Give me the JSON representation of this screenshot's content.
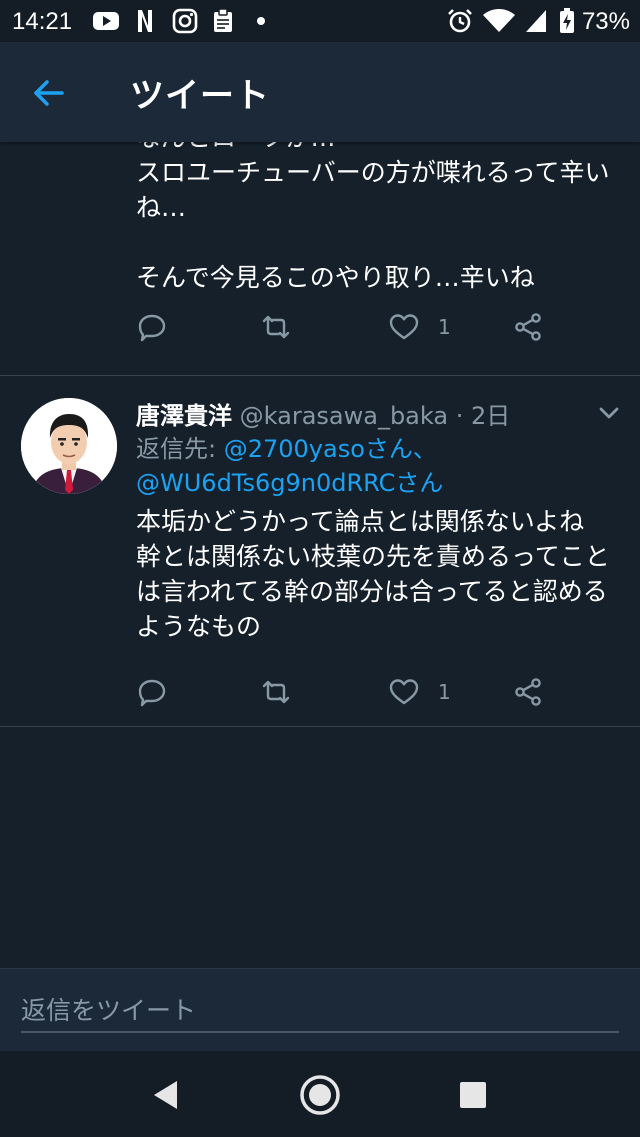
{
  "status_bar": {
    "time": "14:21",
    "notification_icons": [
      "youtube-icon",
      "netflix-icon",
      "instagram-icon",
      "clipboard-icon",
      "dot-icon"
    ],
    "system_icons": [
      "alarm-icon",
      "wifi-icon",
      "signal-icon",
      "battery-icon"
    ],
    "battery": "73%"
  },
  "header": {
    "title": "ツイート",
    "accent_color": "#1da1f2"
  },
  "tweets": [
    {
      "text": "なんとローツか…\nスロユーチューバーの方が喋れるって辛いね…\n\nそんで今見るこのやり取り…辛いね",
      "reply_count": "",
      "retweet_count": "",
      "like_count": "1"
    },
    {
      "name": "唐澤貴洋",
      "handle": "@karasawa_baka",
      "separator": "·",
      "time": "2日",
      "reply_label": "返信先: ",
      "reply_mention1": "@2700yasoさん、",
      "reply_mention2": "@WU6dTs6g9n0dRRCさん",
      "text": "本垢かどうかって論点とは関係ないよね\n幹とは関係ない枝葉の先を責めるってことは言われてる幹の部分は合ってると認めるようなもの",
      "like_count": "1"
    }
  ],
  "compose": {
    "placeholder": "返信をツイート"
  },
  "colors": {
    "background": "#15202b",
    "bar": "#1c2938",
    "muted": "#8899a6",
    "link": "#1da1f2",
    "divider": "#38444d"
  }
}
